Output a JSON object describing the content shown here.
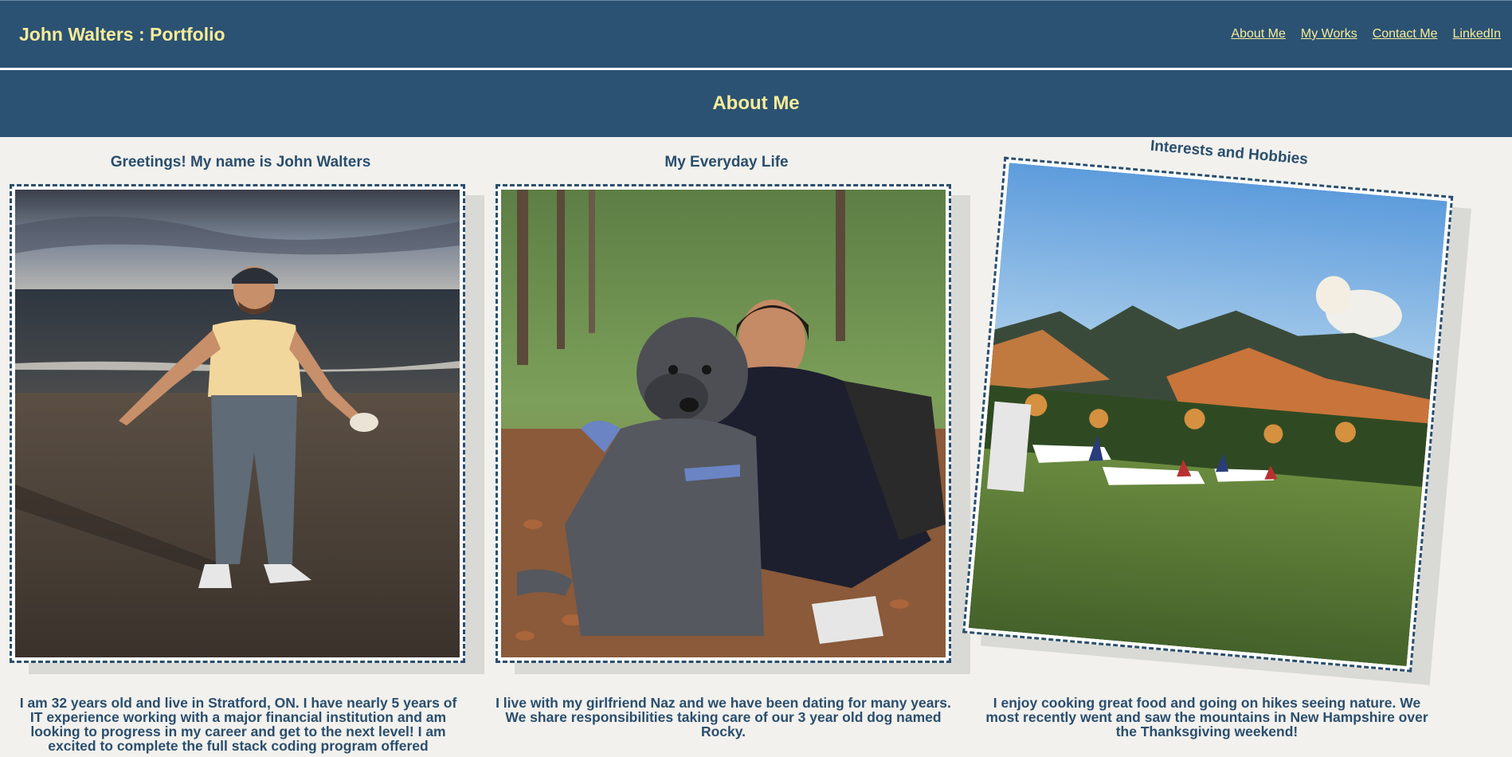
{
  "header": {
    "brand": "John Walters : Portfolio",
    "nav": [
      {
        "label": "About Me "
      },
      {
        "label": "My Works "
      },
      {
        "label": "Contact Me "
      },
      {
        "label": "LinkedIn"
      }
    ]
  },
  "section": {
    "title": "About Me"
  },
  "columns": [
    {
      "heading": "Greetings! My name is John Walters",
      "photo_icon": "beach-portrait-photo",
      "caption": "I am 32 years old and live in Stratford, ON. I have nearly 5 years of IT experience working with a major financial institution and am looking to progress in my career and get to the next level! I am excited to complete the full stack coding program offered"
    },
    {
      "heading": "My Everyday Life",
      "photo_icon": "dog-and-girlfriend-photo",
      "caption": "I live with my girlfriend Naz and we have been dating for many years. We share responsibilities taking care of our 3 year old dog named Rocky."
    },
    {
      "heading": "Interests and Hobbies",
      "photo_icon": "mountain-airfield-photo",
      "caption": "I enjoy cooking great food and going on hikes seeing nature. We most recently went and saw the mountains in New Hampshire over the Thanksgiving weekend!"
    }
  ],
  "colors": {
    "navy": "#2b5273",
    "accent_yellow": "#f8ec9a",
    "page_bg": "#f2f1ed",
    "text": "#2a4e6e"
  }
}
